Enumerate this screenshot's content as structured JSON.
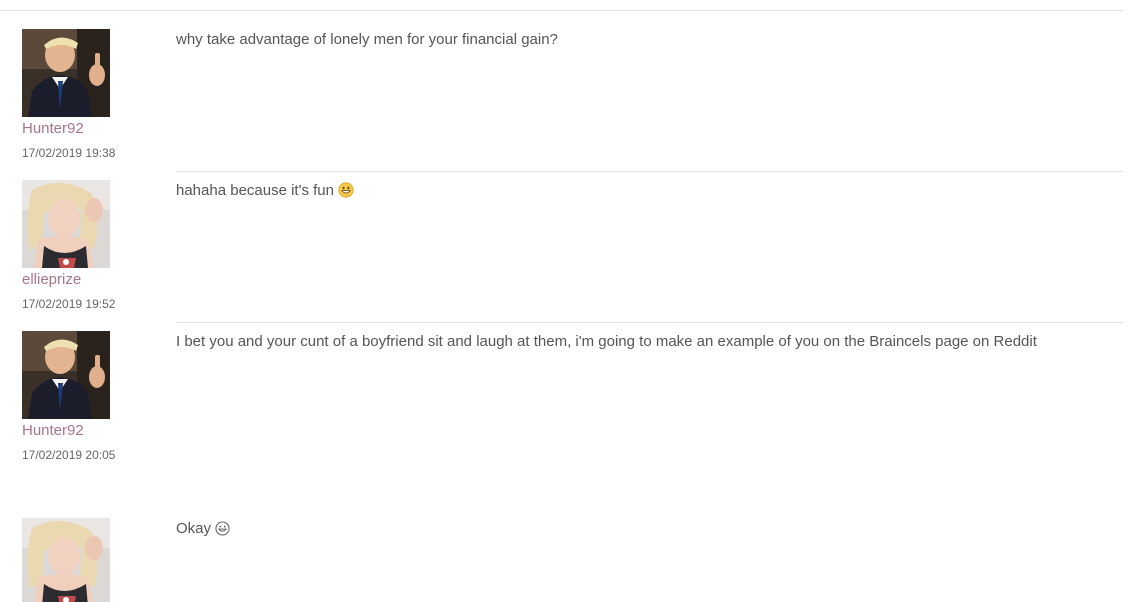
{
  "thread": {
    "messages": [
      {
        "username": "Hunter92",
        "timestamp": "17/02/2019 19:38",
        "text": "why take advantage of lonely men for your financial gain?",
        "emoji": "",
        "avatar": "man-in-suit-thumbs-up"
      },
      {
        "username": "ellieprize",
        "timestamp": "17/02/2019 19:52",
        "text": "hahaha because it's fun",
        "emoji": "grinning-face",
        "avatar": "blonde-woman-selfie"
      },
      {
        "username": "Hunter92",
        "timestamp": "17/02/2019 20:05",
        "text": "I bet you and your cunt of a boyfriend sit and laugh at them, i'm going to make an example of you on the Braincels page on Reddit",
        "emoji": "",
        "avatar": "man-in-suit-thumbs-up"
      },
      {
        "text": "Okay",
        "emoji": "grinning-face-outline",
        "avatar": "blonde-woman-selfie"
      }
    ]
  },
  "colors": {
    "username": "#a8768b",
    "body_text": "#555555",
    "timestamp": "#666666",
    "divider": "#e3e3e3"
  }
}
